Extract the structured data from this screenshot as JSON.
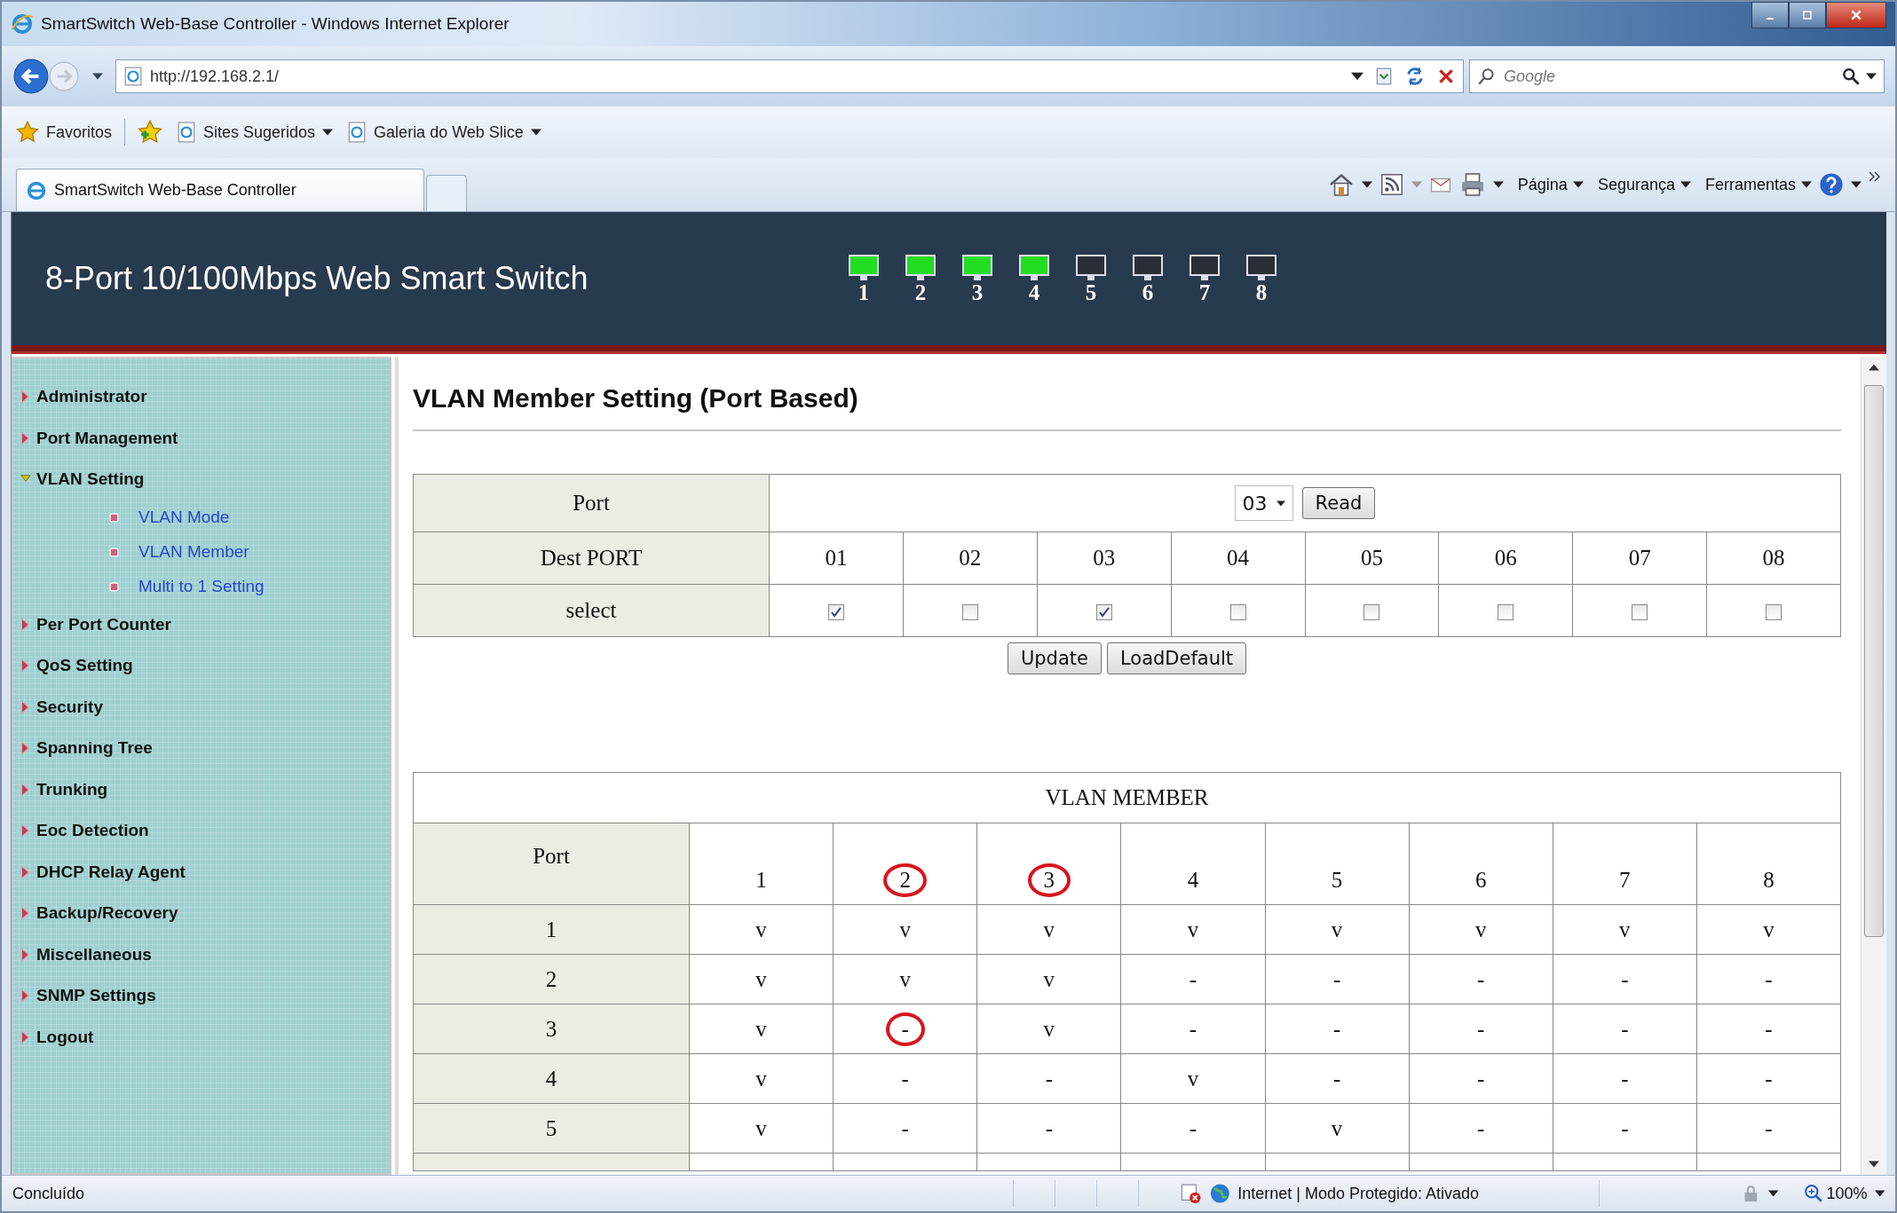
{
  "window": {
    "title": "SmartSwitch Web-Base Controller - Windows Internet Explorer"
  },
  "address_bar": {
    "url": "http://192.168.2.1/"
  },
  "search": {
    "placeholder": "Google"
  },
  "favorites_bar": {
    "favorites": "Favoritos",
    "items": [
      "Sites Sugeridos",
      "Galeria do Web Slice"
    ]
  },
  "tabs": [
    {
      "label": "SmartSwitch Web-Base Controller",
      "selected": true
    }
  ],
  "command_bar": {
    "menus": [
      "Página",
      "Segurança",
      "Ferramentas"
    ]
  },
  "header": {
    "title": "8-Port 10/100Mbps Web Smart Switch",
    "ports": [
      {
        "label": "1",
        "link": true
      },
      {
        "label": "2",
        "link": true
      },
      {
        "label": "3",
        "link": true
      },
      {
        "label": "4",
        "link": true
      },
      {
        "label": "5",
        "link": false
      },
      {
        "label": "6",
        "link": false
      },
      {
        "label": "7",
        "link": false
      },
      {
        "label": "8",
        "link": false
      }
    ]
  },
  "sidebar": {
    "items": [
      {
        "label": "Administrator",
        "expanded": false
      },
      {
        "label": "Port Management",
        "expanded": false
      },
      {
        "label": "VLAN Setting",
        "expanded": true,
        "children": [
          "VLAN Mode",
          "VLAN Member",
          "Multi to 1 Setting"
        ]
      },
      {
        "label": "Per Port Counter",
        "expanded": false
      },
      {
        "label": "QoS Setting",
        "expanded": false
      },
      {
        "label": "Security",
        "expanded": false
      },
      {
        "label": "Spanning Tree",
        "expanded": false
      },
      {
        "label": "Trunking",
        "expanded": false
      },
      {
        "label": "Eoc Detection",
        "expanded": false
      },
      {
        "label": "DHCP Relay Agent",
        "expanded": false
      },
      {
        "label": "Backup/Recovery",
        "expanded": false
      },
      {
        "label": "Miscellaneous",
        "expanded": false
      },
      {
        "label": "SNMP Settings",
        "expanded": false
      },
      {
        "label": "Logout",
        "expanded": false
      }
    ]
  },
  "page_title": "VLAN Member Setting (Port Based)",
  "setting_form": {
    "port_label": "Port",
    "port_value": "03",
    "read_button": "Read",
    "dest_label": "Dest PORT",
    "select_label": "select",
    "dest_ports": [
      {
        "label": "01",
        "checked": true
      },
      {
        "label": "02",
        "checked": false
      },
      {
        "label": "03",
        "checked": true
      },
      {
        "label": "04",
        "checked": false
      },
      {
        "label": "05",
        "checked": false
      },
      {
        "label": "06",
        "checked": false
      },
      {
        "label": "07",
        "checked": false
      },
      {
        "label": "08",
        "checked": false
      }
    ],
    "buttons": [
      "Update",
      "LoadDefault"
    ]
  },
  "vlan_member": {
    "title": "VLAN MEMBER",
    "corner": "Port",
    "columns": [
      {
        "text": "1",
        "circled": false
      },
      {
        "text": "2",
        "circled": true
      },
      {
        "text": "3",
        "circled": true
      },
      {
        "text": "4",
        "circled": false
      },
      {
        "text": "5",
        "circled": false
      },
      {
        "text": "6",
        "circled": false
      },
      {
        "text": "7",
        "circled": false
      },
      {
        "text": "8",
        "circled": false
      }
    ],
    "rows": [
      {
        "port": "1",
        "cells": [
          {
            "text": "v",
            "circled": false
          },
          {
            "text": "v",
            "circled": false
          },
          {
            "text": "v",
            "circled": false
          },
          {
            "text": "v",
            "circled": false
          },
          {
            "text": "v",
            "circled": false
          },
          {
            "text": "v",
            "circled": false
          },
          {
            "text": "v",
            "circled": false
          },
          {
            "text": "v",
            "circled": false
          }
        ]
      },
      {
        "port": "2",
        "cells": [
          {
            "text": "v",
            "circled": false
          },
          {
            "text": "v",
            "circled": false
          },
          {
            "text": "v",
            "circled": false
          },
          {
            "text": "-",
            "circled": false
          },
          {
            "text": "-",
            "circled": false
          },
          {
            "text": "-",
            "circled": false
          },
          {
            "text": "-",
            "circled": false
          },
          {
            "text": "-",
            "circled": false
          }
        ]
      },
      {
        "port": "3",
        "cells": [
          {
            "text": "v",
            "circled": false
          },
          {
            "text": "-",
            "circled": true
          },
          {
            "text": "v",
            "circled": false
          },
          {
            "text": "-",
            "circled": false
          },
          {
            "text": "-",
            "circled": false
          },
          {
            "text": "-",
            "circled": false
          },
          {
            "text": "-",
            "circled": false
          },
          {
            "text": "-",
            "circled": false
          }
        ]
      },
      {
        "port": "4",
        "cells": [
          {
            "text": "v",
            "circled": false
          },
          {
            "text": "-",
            "circled": false
          },
          {
            "text": "-",
            "circled": false
          },
          {
            "text": "v",
            "circled": false
          },
          {
            "text": "-",
            "circled": false
          },
          {
            "text": "-",
            "circled": false
          },
          {
            "text": "-",
            "circled": false
          },
          {
            "text": "-",
            "circled": false
          }
        ]
      },
      {
        "port": "5",
        "cells": [
          {
            "text": "v",
            "circled": false
          },
          {
            "text": "-",
            "circled": false
          },
          {
            "text": "-",
            "circled": false
          },
          {
            "text": "-",
            "circled": false
          },
          {
            "text": "v",
            "circled": false
          },
          {
            "text": "-",
            "circled": false
          },
          {
            "text": "-",
            "circled": false
          },
          {
            "text": "-",
            "circled": false
          }
        ]
      }
    ]
  },
  "status_bar": {
    "text": "Concluído",
    "zone": "Internet | Modo Protegido: Ativado",
    "zoom": "100%"
  }
}
